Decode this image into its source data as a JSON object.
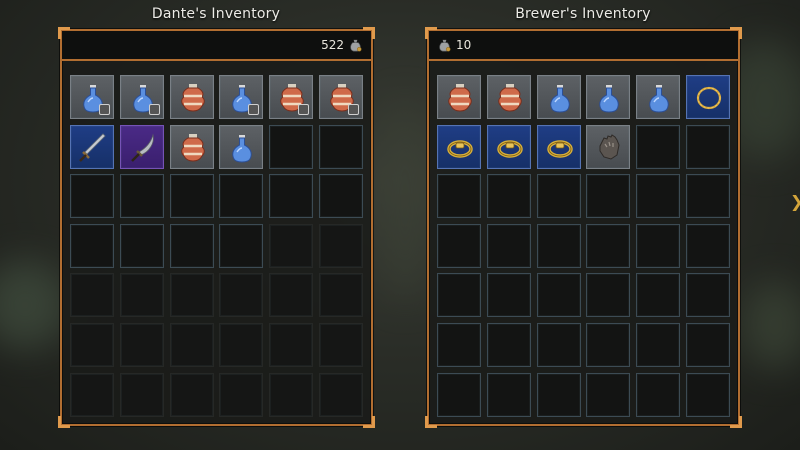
{
  "left": {
    "title": "Dante's Inventory",
    "gold": "522",
    "slots": [
      {
        "item": "mana-potion",
        "style": "filled",
        "qty": true
      },
      {
        "item": "mana-potion",
        "style": "filled",
        "qty": true
      },
      {
        "item": "health-potion",
        "style": "filled",
        "qty": false
      },
      {
        "item": "mana-potion",
        "style": "filled",
        "qty": true
      },
      {
        "item": "health-potion",
        "style": "filled",
        "qty": true
      },
      {
        "item": "health-potion",
        "style": "filled",
        "qty": true
      },
      {
        "item": "sword",
        "style": "blue",
        "qty": false
      },
      {
        "item": "scimitar",
        "style": "purple",
        "qty": false
      },
      {
        "item": "health-potion",
        "style": "filled",
        "qty": false
      },
      {
        "item": "mana-potion",
        "style": "filled",
        "qty": false
      },
      {
        "item": "",
        "style": "empty"
      },
      {
        "item": "",
        "style": "empty"
      },
      {
        "item": "",
        "style": "empty"
      },
      {
        "item": "",
        "style": "empty"
      },
      {
        "item": "",
        "style": "empty"
      },
      {
        "item": "",
        "style": "empty"
      },
      {
        "item": "",
        "style": "empty"
      },
      {
        "item": "",
        "style": "empty"
      },
      {
        "item": "",
        "style": "empty"
      },
      {
        "item": "",
        "style": "empty"
      },
      {
        "item": "",
        "style": "empty"
      },
      {
        "item": "",
        "style": "empty"
      },
      {
        "item": "",
        "style": "dark"
      },
      {
        "item": "",
        "style": "dark"
      },
      {
        "item": "",
        "style": "dark"
      },
      {
        "item": "",
        "style": "dark"
      },
      {
        "item": "",
        "style": "dark"
      },
      {
        "item": "",
        "style": "dark"
      },
      {
        "item": "",
        "style": "dark"
      },
      {
        "item": "",
        "style": "dark"
      },
      {
        "item": "",
        "style": "dark"
      },
      {
        "item": "",
        "style": "dark"
      },
      {
        "item": "",
        "style": "dark"
      },
      {
        "item": "",
        "style": "dark"
      },
      {
        "item": "",
        "style": "dark"
      },
      {
        "item": "",
        "style": "dark"
      },
      {
        "item": "",
        "style": "dark"
      },
      {
        "item": "",
        "style": "dark"
      },
      {
        "item": "",
        "style": "dark"
      },
      {
        "item": "",
        "style": "dark"
      },
      {
        "item": "",
        "style": "dark"
      },
      {
        "item": "",
        "style": "dark"
      }
    ]
  },
  "right": {
    "title": "Brewer's Inventory",
    "gold": "10",
    "slots": [
      {
        "item": "health-potion",
        "style": "filled",
        "qty": false
      },
      {
        "item": "health-potion",
        "style": "filled",
        "qty": false
      },
      {
        "item": "mana-potion",
        "style": "filled",
        "qty": false
      },
      {
        "item": "mana-potion",
        "style": "filled",
        "qty": false
      },
      {
        "item": "mana-potion",
        "style": "filled",
        "qty": false
      },
      {
        "item": "gold-necklace",
        "style": "blue",
        "qty": false
      },
      {
        "item": "gold-ring",
        "style": "blue",
        "qty": false
      },
      {
        "item": "gold-ring",
        "style": "blue",
        "qty": false
      },
      {
        "item": "gold-ring",
        "style": "blue",
        "qty": false
      },
      {
        "item": "gauntlet",
        "style": "filled",
        "qty": false
      },
      {
        "item": "",
        "style": "empty"
      },
      {
        "item": "",
        "style": "empty"
      },
      {
        "item": "",
        "style": "empty"
      },
      {
        "item": "",
        "style": "empty"
      },
      {
        "item": "",
        "style": "empty"
      },
      {
        "item": "",
        "style": "empty"
      },
      {
        "item": "",
        "style": "empty"
      },
      {
        "item": "",
        "style": "empty"
      },
      {
        "item": "",
        "style": "empty"
      },
      {
        "item": "",
        "style": "empty"
      },
      {
        "item": "",
        "style": "empty"
      },
      {
        "item": "",
        "style": "empty"
      },
      {
        "item": "",
        "style": "empty"
      },
      {
        "item": "",
        "style": "empty"
      },
      {
        "item": "",
        "style": "empty"
      },
      {
        "item": "",
        "style": "empty"
      },
      {
        "item": "",
        "style": "empty"
      },
      {
        "item": "",
        "style": "empty"
      },
      {
        "item": "",
        "style": "empty"
      },
      {
        "item": "",
        "style": "empty"
      },
      {
        "item": "",
        "style": "empty"
      },
      {
        "item": "",
        "style": "empty"
      },
      {
        "item": "",
        "style": "empty"
      },
      {
        "item": "",
        "style": "empty"
      },
      {
        "item": "",
        "style": "empty"
      },
      {
        "item": "",
        "style": "empty"
      },
      {
        "item": "",
        "style": "empty"
      },
      {
        "item": "",
        "style": "empty"
      },
      {
        "item": "",
        "style": "empty"
      },
      {
        "item": "",
        "style": "empty"
      },
      {
        "item": "",
        "style": "empty"
      },
      {
        "item": "",
        "style": "empty"
      }
    ]
  },
  "colors": {
    "frame": "#b26e31",
    "slot_border": "#3c4b54",
    "rare": "#1f3d85",
    "epic": "#4a2a86"
  }
}
